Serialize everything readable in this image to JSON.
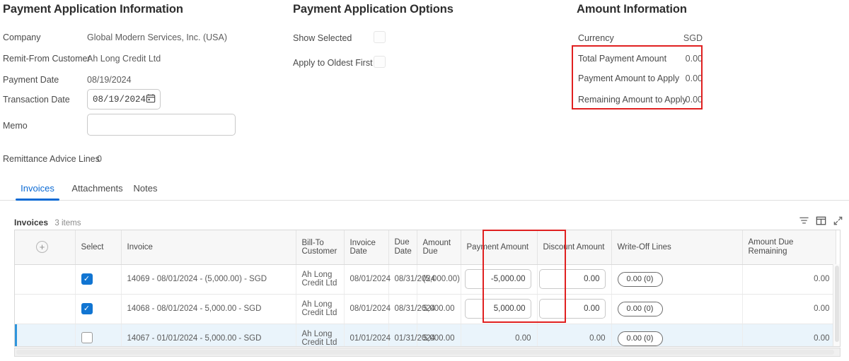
{
  "payment_application_information": {
    "title": "Payment Application Information",
    "fields": [
      {
        "label": "Company",
        "value": "Global Modern Services, Inc. (USA)"
      },
      {
        "label": "Remit-From Customer",
        "value": "Ah Long Credit Ltd"
      },
      {
        "label": "Payment Date",
        "value": "08/19/2024"
      },
      {
        "label": "Transaction Date",
        "value": "08/19/2024"
      },
      {
        "label": "Memo",
        "value": ""
      }
    ],
    "transaction_date_value": "08/19/2024",
    "memo_value": "",
    "remittance_advice_lines_label": "Remittance Advice Lines",
    "remittance_advice_lines_value": "0"
  },
  "payment_application_options": {
    "title": "Payment Application Options",
    "options": [
      {
        "label": "Show Selected",
        "checked": false
      },
      {
        "label": "Apply to Oldest First",
        "checked": false
      }
    ]
  },
  "amount_information": {
    "title": "Amount Information",
    "rows": [
      {
        "label": "Currency",
        "value": "SGD"
      },
      {
        "label": "Total Payment Amount",
        "value": "0.00"
      },
      {
        "label": "Payment Amount to Apply",
        "value": "0.00"
      },
      {
        "label": "Remaining Amount to Apply",
        "value": "0.00"
      }
    ]
  },
  "tabs": [
    {
      "label": "Invoices",
      "active": true
    },
    {
      "label": "Attachments",
      "active": false
    },
    {
      "label": "Notes",
      "active": false
    }
  ],
  "grid": {
    "caption": "Invoices",
    "item_count": "3 items",
    "toolbar_icons": [
      "filter-icon",
      "table-view-icon",
      "expand-icon"
    ],
    "add_row_glyph": "+",
    "columns": [
      "",
      "Select",
      "Invoice",
      "Bill-To Customer",
      "Invoice Date",
      "Due Date",
      "Amount Due",
      "Payment Amount",
      "Discount Amount",
      "Write-Off Lines",
      "Amount Due Remaining"
    ],
    "rows": [
      {
        "selected": true,
        "invoice": "14069 - 08/01/2024 - (5,000.00) - SGD",
        "bill_to_customer": "Ah Long Credit Ltd",
        "invoice_date": "08/01/2024",
        "due_date": "08/31/2024",
        "amount_due": "(5,000.00)",
        "payment_amount": "-5,000.00",
        "payment_amount_is_input": true,
        "discount_amount": "0.00",
        "discount_amount_is_input": true,
        "write_off_lines": "0.00 (0)",
        "amount_due_remaining": "0.00",
        "highlighted": false
      },
      {
        "selected": true,
        "invoice": "14068 - 08/01/2024 - 5,000.00 - SGD",
        "bill_to_customer": "Ah Long Credit Ltd",
        "invoice_date": "08/01/2024",
        "due_date": "08/31/2024",
        "amount_due": "5,000.00",
        "payment_amount": "5,000.00",
        "payment_amount_is_input": true,
        "discount_amount": "0.00",
        "discount_amount_is_input": true,
        "write_off_lines": "0.00 (0)",
        "amount_due_remaining": "0.00",
        "highlighted": false
      },
      {
        "selected": false,
        "invoice": "14067 - 01/01/2024 - 5,000.00 - SGD",
        "bill_to_customer": "Ah Long Credit Ltd",
        "invoice_date": "01/01/2024",
        "due_date": "01/31/2024",
        "amount_due": "5,000.00",
        "payment_amount": "0.00",
        "payment_amount_is_input": false,
        "discount_amount": "0.00",
        "discount_amount_is_input": false,
        "write_off_lines": "0.00 (0)",
        "amount_due_remaining": "0.00",
        "highlighted": true
      }
    ]
  },
  "annotations": {
    "highlight_color": "#e02020",
    "accent_color": "#0b6ad4",
    "checkbox_color": "#1175d2",
    "row_highlight_color": "#eaf4fb"
  }
}
